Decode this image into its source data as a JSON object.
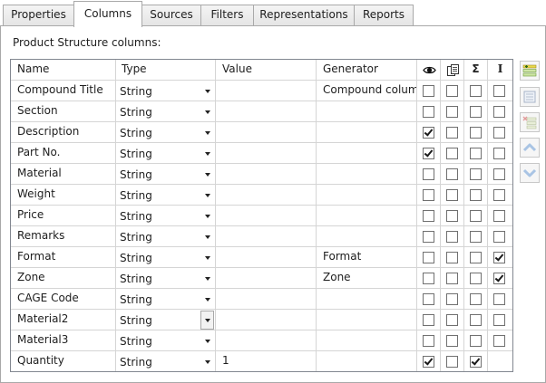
{
  "tabs": [
    {
      "label": "Properties",
      "active": false
    },
    {
      "label": "Columns",
      "active": true
    },
    {
      "label": "Sources",
      "active": false
    },
    {
      "label": "Filters",
      "active": false
    },
    {
      "label": "Representations",
      "active": false
    },
    {
      "label": "Reports",
      "active": false
    }
  ],
  "caption": "Product Structure columns:",
  "grid": {
    "headers": {
      "name": "Name",
      "type": "Type",
      "value": "Value",
      "generator": "Generator",
      "col1_icon": "eye-icon",
      "col2_icon": "copy-icon",
      "col3_glyph": "Σ",
      "col4_glyph": "I"
    },
    "rows": [
      {
        "name": "Compound Title",
        "type": "String",
        "value": "",
        "generator": "Compound column",
        "c1": false,
        "c2": false,
        "c3": false,
        "c4": false
      },
      {
        "name": "Section",
        "type": "String",
        "value": "",
        "generator": "",
        "c1": false,
        "c2": false,
        "c3": false,
        "c4": false
      },
      {
        "name": "Description",
        "type": "String",
        "value": "",
        "generator": "",
        "c1": true,
        "c2": false,
        "c3": false,
        "c4": false
      },
      {
        "name": "Part No.",
        "type": "String",
        "value": "",
        "generator": "",
        "c1": true,
        "c2": false,
        "c3": false,
        "c4": false
      },
      {
        "name": "Material",
        "type": "String",
        "value": "",
        "generator": "",
        "c1": false,
        "c2": false,
        "c3": false,
        "c4": false
      },
      {
        "name": "Weight",
        "type": "String",
        "value": "",
        "generator": "",
        "c1": false,
        "c2": false,
        "c3": false,
        "c4": false
      },
      {
        "name": "Price",
        "type": "String",
        "value": "",
        "generator": "",
        "c1": false,
        "c2": false,
        "c3": false,
        "c4": false
      },
      {
        "name": "Remarks",
        "type": "String",
        "value": "",
        "generator": "",
        "c1": false,
        "c2": false,
        "c3": false,
        "c4": false
      },
      {
        "name": "Format",
        "type": "String",
        "value": "",
        "generator": "Format",
        "c1": false,
        "c2": false,
        "c3": false,
        "c4": true
      },
      {
        "name": "Zone",
        "type": "String",
        "value": "",
        "generator": "Zone",
        "c1": false,
        "c2": false,
        "c3": false,
        "c4": true
      },
      {
        "name": "CAGE Code",
        "type": "String",
        "value": "",
        "generator": "",
        "c1": false,
        "c2": false,
        "c3": false,
        "c4": false
      },
      {
        "name": "Material2",
        "type": "String",
        "value": "",
        "generator": "",
        "c1": false,
        "c2": false,
        "c3": false,
        "c4": false,
        "focused": true
      },
      {
        "name": "Material3",
        "type": "String",
        "value": "",
        "generator": "",
        "c1": false,
        "c2": false,
        "c3": false,
        "c4": false
      },
      {
        "name": "Quantity",
        "type": "String",
        "value": "1",
        "generator": "",
        "c1": true,
        "c2": false,
        "c3": true,
        "c4": null
      }
    ]
  },
  "toolbar": [
    {
      "name": "add-column-button",
      "icon": "add-column-icon",
      "enabled": true
    },
    {
      "name": "edit-column-button",
      "icon": "edit-column-icon",
      "enabled": false
    },
    {
      "name": "delete-column-button",
      "icon": "delete-column-icon",
      "enabled": false
    },
    {
      "name": "move-up-button",
      "icon": "arrow-up-icon",
      "enabled": false
    },
    {
      "name": "move-down-button",
      "icon": "arrow-down-icon",
      "enabled": false
    }
  ]
}
